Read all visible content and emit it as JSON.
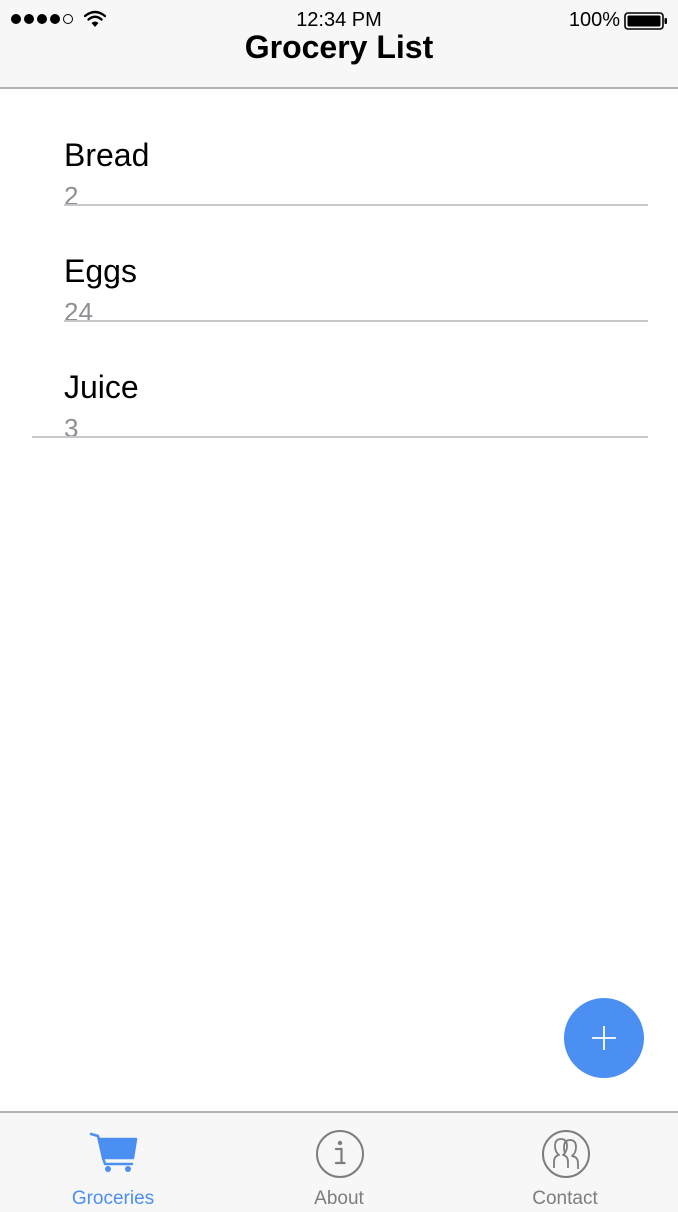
{
  "status_bar": {
    "time": "12:34 PM",
    "battery_percent": "100%",
    "signal_bars_filled": 4,
    "signal_bars_total": 5
  },
  "header": {
    "title": "Grocery List"
  },
  "items": [
    {
      "name": "Bread",
      "quantity": "2"
    },
    {
      "name": "Eggs",
      "quantity": "24"
    },
    {
      "name": "Juice",
      "quantity": "3"
    }
  ],
  "fab": {
    "icon": "plus-icon"
  },
  "tabs": [
    {
      "label": "Groceries",
      "icon": "cart-icon",
      "active": true
    },
    {
      "label": "About",
      "icon": "info-icon",
      "active": false
    },
    {
      "label": "Contact",
      "icon": "contacts-icon",
      "active": false
    }
  ],
  "colors": {
    "accent": "#4a8ff1",
    "inactive": "#7d7d7d",
    "bar_background": "#f7f7f7",
    "secondary_text": "#8e8e93"
  }
}
